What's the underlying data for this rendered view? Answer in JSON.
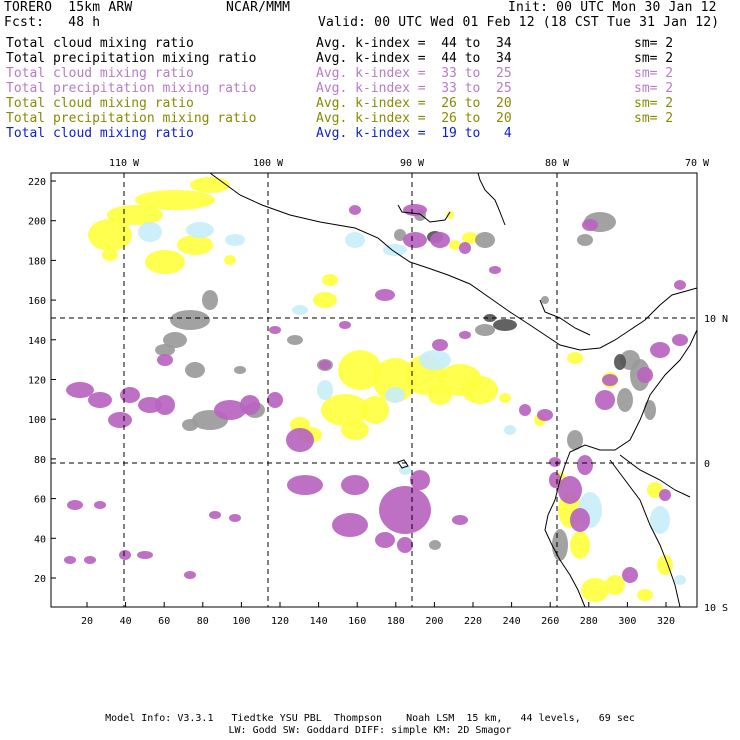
{
  "header": {
    "left_line1": "TORERO  15km ARW",
    "center_line1": "NCAR/MMM",
    "right_line1": "Init: 00 UTC Mon 30 Jan 12",
    "left_line2": "Fcst:   48 h",
    "right_line2": "Valid: 00 UTC Wed 01 Feb 12 (18 CST Tue 31 Jan 12)"
  },
  "legend": [
    {
      "name": "Total cloud mixing ratio",
      "index": "Avg. k-index =  44 to  34",
      "smooth": "sm= 2",
      "color": "#000000"
    },
    {
      "name": "Total precipitation mixing ratio",
      "index": "Avg. k-index =  44 to  34",
      "smooth": "sm= 2",
      "color": "#000000"
    },
    {
      "name": "Total cloud mixing ratio",
      "index": "Avg. k-index =  33 to  25",
      "smooth": "sm= 2",
      "color": "#b77cc6"
    },
    {
      "name": "Total precipitation mixing ratio",
      "index": "Avg. k-index =  33 to  25",
      "smooth": "sm= 2",
      "color": "#b77cc6"
    },
    {
      "name": "Total cloud mixing ratio",
      "index": "Avg. k-index =  26 to  20",
      "smooth": "sm= 2",
      "color": "#8a8a00"
    },
    {
      "name": "Total precipitation mixing ratio",
      "index": "Avg. k-index =  26 to  20",
      "smooth": "sm= 2",
      "color": "#8a8a00"
    },
    {
      "name": "Total cloud mixing ratio",
      "index": "Avg. k-index =  19 to   4",
      "smooth": "",
      "color": "#1020d0"
    }
  ],
  "map": {
    "lon_labels": [
      "110 W",
      "100 W",
      "90 W",
      "80 W",
      "70 W"
    ],
    "lat_labels": [
      "10 N",
      "0",
      "10 S"
    ],
    "y_ticks": [
      "220",
      "200",
      "180",
      "160",
      "140",
      "120",
      "100",
      "80",
      "60",
      "40",
      "20"
    ],
    "x_ticks": [
      "20",
      "40",
      "60",
      "80",
      "100",
      "120",
      "140",
      "160",
      "180",
      "200",
      "220",
      "240",
      "260",
      "280",
      "300",
      "320"
    ],
    "colors": {
      "gray": "#9a9a9a",
      "dark_gray": "#555555",
      "purple": "#b864c0",
      "yellow": "#ffff40",
      "light_blue": "#c8eefa",
      "coast": "#000000"
    }
  },
  "footer": {
    "line1": "Model Info: V3.3.1   Tiedtke YSU PBL  Thompson    Noah LSM  15 km,   44 levels,   69 sec",
    "line2": "LW: Godd SW: Goddard DIFF: simple KM: 2D Smagor"
  }
}
